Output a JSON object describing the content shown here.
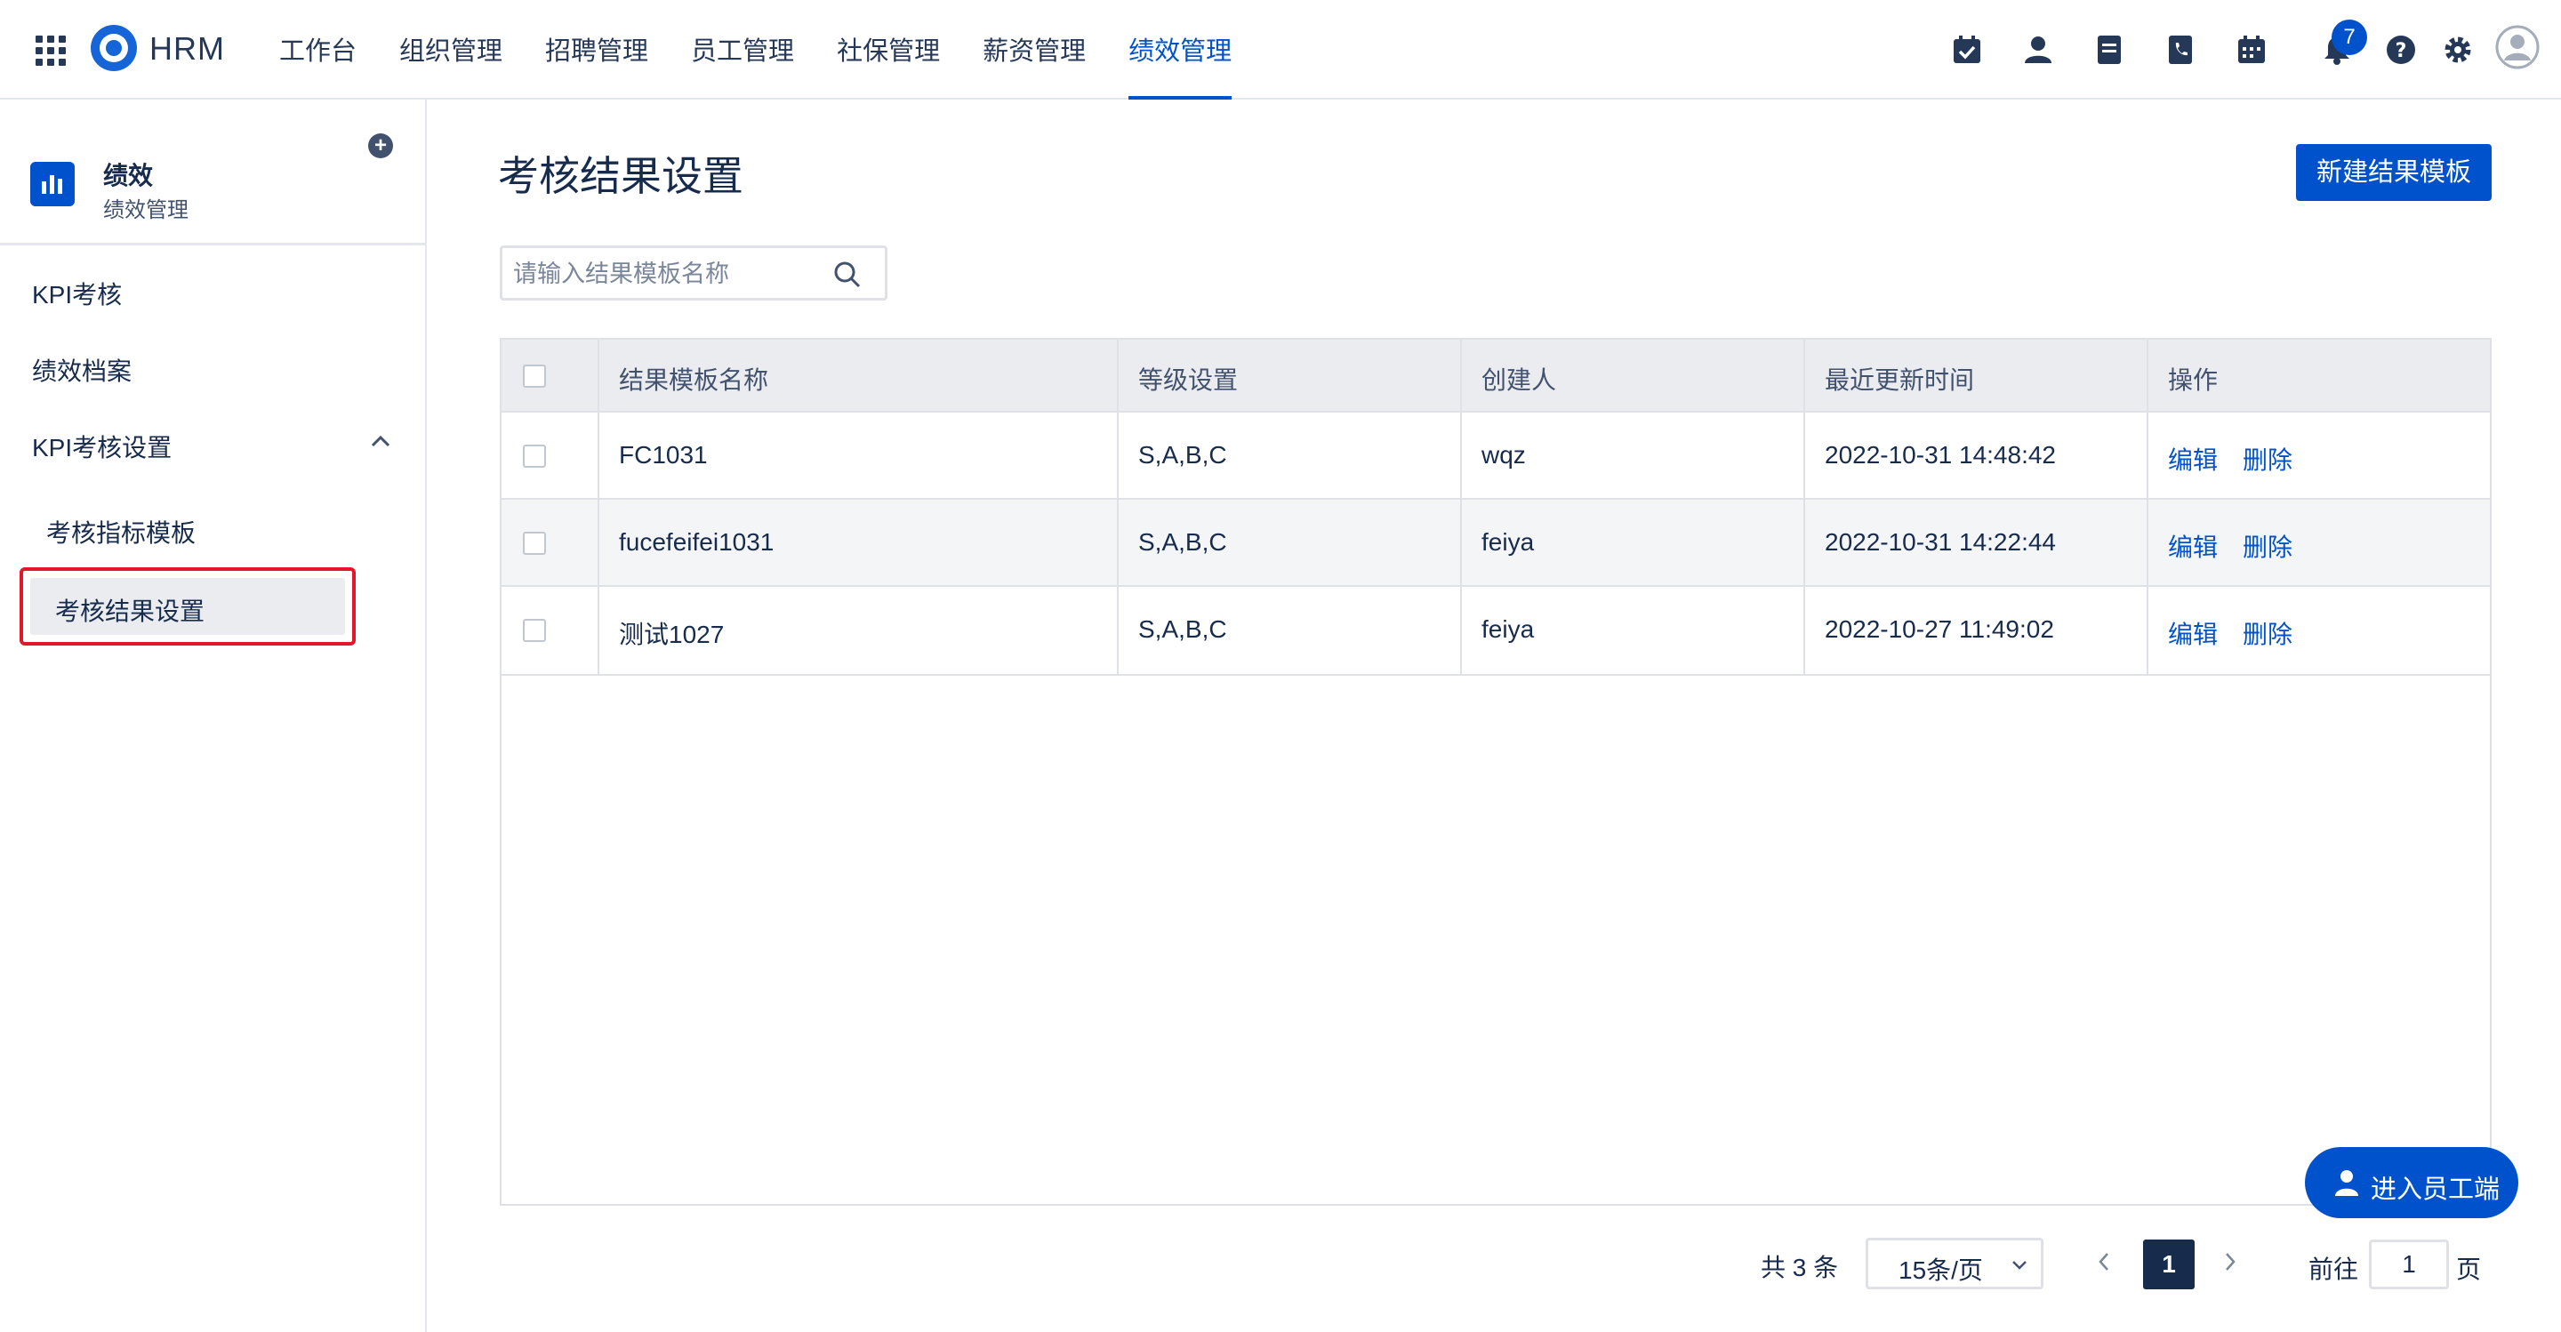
{
  "app": {
    "brand": "HRM"
  },
  "nav": [
    "工作台",
    "组织管理",
    "招聘管理",
    "员工管理",
    "社保管理",
    "薪资管理",
    "绩效管理"
  ],
  "notifications": {
    "count": "7"
  },
  "sidebar": {
    "title": "绩效",
    "subtitle": "绩效管理",
    "items": [
      {
        "label": "KPI考核"
      },
      {
        "label": "绩效档案"
      },
      {
        "label": "KPI考核设置",
        "expanded": true
      },
      {
        "label": "考核指标模板"
      },
      {
        "label": "考核结果设置",
        "selected": true
      }
    ]
  },
  "page": {
    "title": "考核结果设置",
    "new_button": "新建结果模板",
    "search_placeholder": "请输入结果模板名称"
  },
  "table": {
    "headers": [
      "结果模板名称",
      "等级设置",
      "创建人",
      "最近更新时间",
      "操作"
    ],
    "rows": [
      {
        "name": "FC1031",
        "grades": "S,A,B,C",
        "creator": "wqz",
        "updated": "2022-10-31 14:48:42"
      },
      {
        "name": "fucefeifei1031",
        "grades": "S,A,B,C",
        "creator": "feiya",
        "updated": "2022-10-31 14:22:44"
      },
      {
        "name": "测试1027",
        "grades": "S,A,B,C",
        "creator": "feiya",
        "updated": "2022-10-27 11:49:02"
      }
    ],
    "actions": {
      "edit": "编辑",
      "delete": "删除"
    }
  },
  "pagination": {
    "total": "共 3 条",
    "page_size": "15条/页",
    "current": "1",
    "goto_label": "前往",
    "goto_value": "1",
    "goto_unit": "页"
  },
  "fab": {
    "label": "进入员工端"
  },
  "colors": {
    "primary": "#0052CC",
    "text": "#172B4D",
    "highlight": "#E3162B"
  }
}
